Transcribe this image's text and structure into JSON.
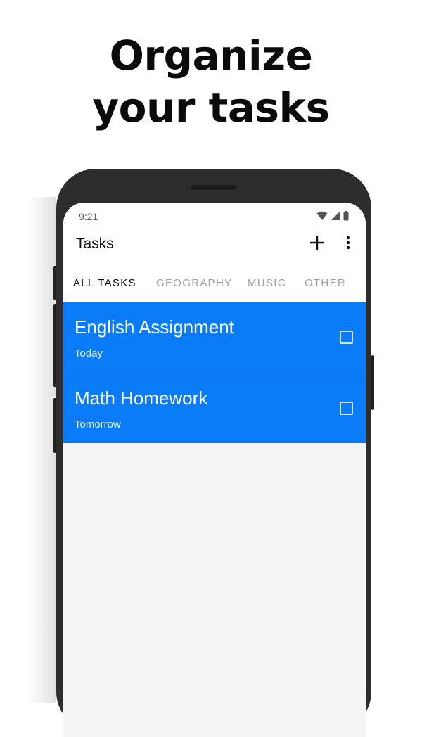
{
  "promo": {
    "line1": "Organize",
    "line2": "your tasks"
  },
  "status_bar": {
    "time": "9:21",
    "icons": [
      "wifi-icon",
      "cellular-signal-icon",
      "battery-icon"
    ]
  },
  "app_bar": {
    "title": "Tasks",
    "add_icon": "plus-icon",
    "menu_icon": "more-vert-icon"
  },
  "tabs": [
    {
      "label": "ALL TASKS",
      "active": true
    },
    {
      "label": "GEOGRAPHY",
      "active": false
    },
    {
      "label": "MUSIC",
      "active": false
    },
    {
      "label": "OTHER",
      "active": false
    }
  ],
  "tasks": [
    {
      "title": "English Assignment",
      "due": "Today",
      "checked": false
    },
    {
      "title": "Math Homework",
      "due": "Tomorrow",
      "checked": false
    }
  ],
  "colors": {
    "accent": "#0a7cf8",
    "background": "#f5f5f5",
    "phone_frame": "#2d2d2d"
  }
}
